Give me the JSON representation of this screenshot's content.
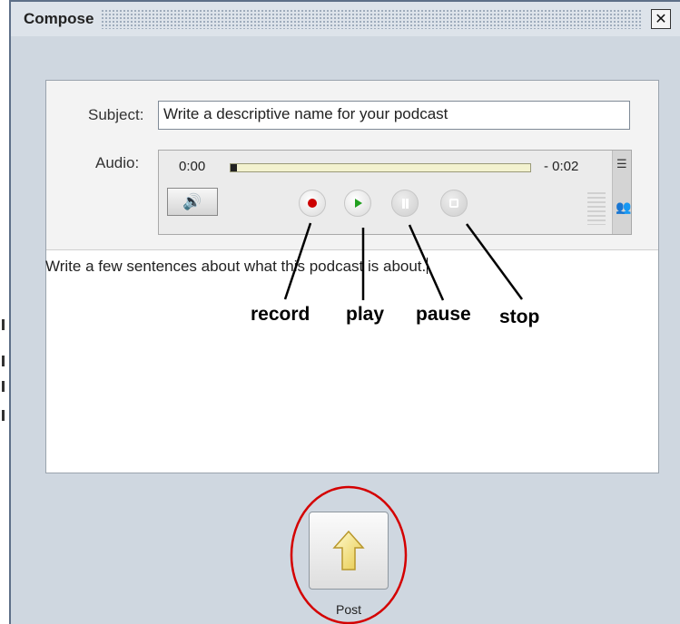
{
  "window": {
    "title": "Compose",
    "close_icon": "close-icon"
  },
  "form": {
    "subject_label": "Subject:",
    "subject_value": "Write a descriptive name for your podcast",
    "audio_label": "Audio:",
    "body_text": "Write a few sentences about what this podcast is about."
  },
  "player": {
    "elapsed": "0:00",
    "remaining": "- 0:02",
    "progress": 0.02,
    "volume_icon": "speaker-icon",
    "buttons": [
      "record",
      "play",
      "pause",
      "stop"
    ]
  },
  "annotations": {
    "record": "record",
    "play": "play",
    "pause": "pause",
    "stop": "stop"
  },
  "post": {
    "label": "Post",
    "icon": "up-arrow-icon",
    "highlight_color": "#d40000"
  }
}
